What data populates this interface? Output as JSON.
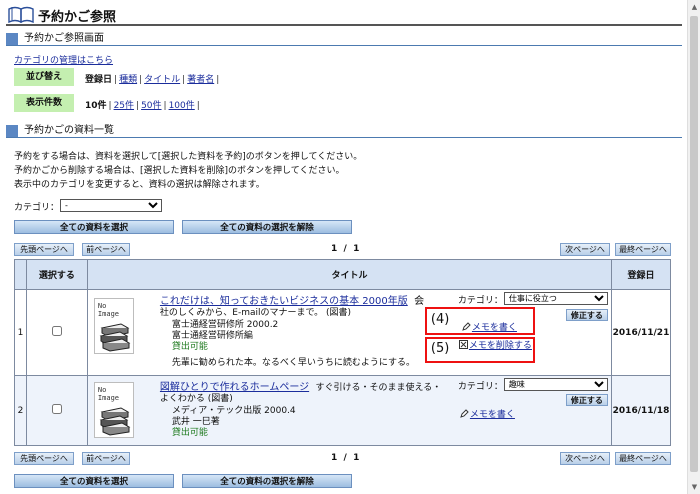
{
  "page": {
    "title": "予約かご参照"
  },
  "section1": {
    "heading": "予約かご参照画面"
  },
  "category_link": "カテゴリの管理はこちら",
  "sort": {
    "label": "並び替え",
    "current": "登録日",
    "options": [
      "種類",
      "タイトル",
      "著者名"
    ]
  },
  "display": {
    "label": "表示件数",
    "current": "10件",
    "options": [
      "25件",
      "50件",
      "100件"
    ]
  },
  "section2": {
    "heading": "予約かごの資料一覧"
  },
  "instructions": [
    "予約をする場合は、資料を選択して[選択した資料を予約]のボタンを押してください。",
    "予約かごから削除する場合は、[選択した資料を削除]のボタンを押してください。",
    "表示中のカテゴリを変更すると、資料の選択は解除されます。"
  ],
  "category_filter": {
    "label": "カテゴリ：",
    "value": "-"
  },
  "buttons": {
    "select_all": "全ての資料を選択",
    "deselect_all": "全ての資料の選択を解除",
    "first_page": "先頭ページへ",
    "prev_page": "前ページへ",
    "next_page": "次ページへ",
    "last_page": "最終ページへ",
    "fix": "修正する"
  },
  "pager": {
    "current": "1",
    "sep": "/",
    "total": "1"
  },
  "table": {
    "headers": {
      "select": "選択する",
      "title": "タイトル",
      "date": "登録日"
    }
  },
  "noimage": {
    "line1": "No",
    "line2": "Image"
  },
  "category_field_label": "カテゴリ：",
  "items": [
    {
      "num": "1",
      "title": "これだけは、知っておきたいビジネスの基本 2000年版",
      "title_after": "会",
      "subtitle": "社のしくみから、E-mailのマナーまで。 (図書)",
      "publisher": "富士通経営研修所 2000.2",
      "author": "富士通経営研修所編",
      "status": "貸出可能",
      "memo": "先輩に勧められた本。なるべく早いうちに読むようにする。",
      "category": "仕事に役立つ",
      "action1": "メモを書く",
      "action2": "メモを削除する",
      "date": "2016/11/21"
    },
    {
      "num": "2",
      "title": "図解ひとりで作れるホームページ",
      "title_after": "すぐ引ける・そのまま使える・",
      "subtitle": "よくわかる (図書)",
      "publisher": "メディア・テック出版 2000.4",
      "author": "武井 一巳著",
      "status": "貸出可能",
      "category": "趣味",
      "action1": "メモを書く",
      "date": "2016/11/18"
    }
  ],
  "annotations": {
    "label4": "(4)",
    "label5": "(5)"
  }
}
